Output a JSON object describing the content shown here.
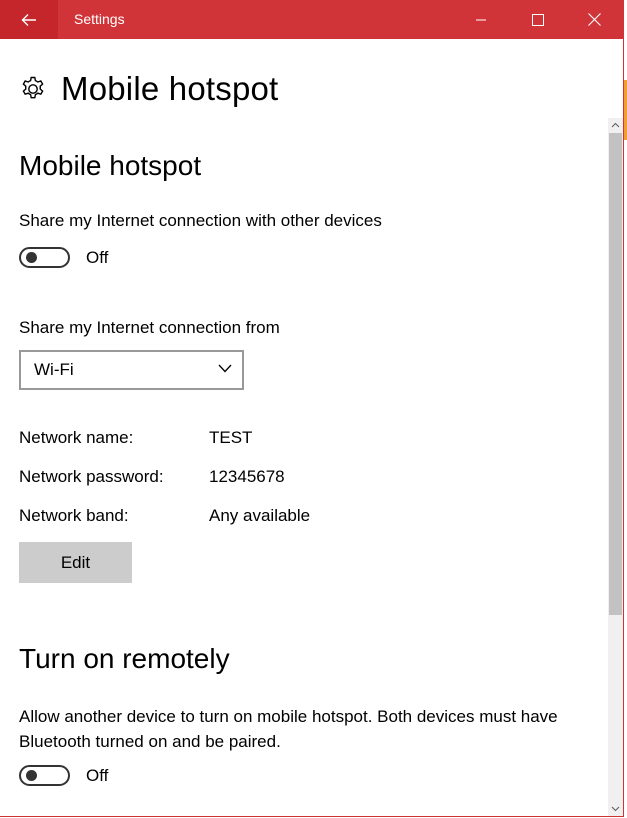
{
  "window": {
    "title": "Settings",
    "back_icon": "back-arrow-icon",
    "minimize_icon": "minimize-icon",
    "maximize_icon": "maximize-icon",
    "close_icon": "close-icon",
    "accent_color": "#d13438"
  },
  "page": {
    "icon": "gear-icon",
    "title": "Mobile hotspot"
  },
  "hotspot": {
    "section_title": "Mobile hotspot",
    "share_label": "Share my Internet connection with other devices",
    "share_toggle_state": "Off",
    "share_from_label": "Share my Internet connection from",
    "share_from_value": "Wi-Fi",
    "network": [
      {
        "key": "Network name:",
        "value": "TEST"
      },
      {
        "key": "Network password:",
        "value": "12345678"
      },
      {
        "key": "Network band:",
        "value": "Any available"
      }
    ],
    "edit_label": "Edit"
  },
  "remote": {
    "section_title": "Turn on remotely",
    "description": "Allow another device to turn on mobile hotspot. Both devices must have Bluetooth turned on and be paired.",
    "toggle_state": "Off"
  }
}
